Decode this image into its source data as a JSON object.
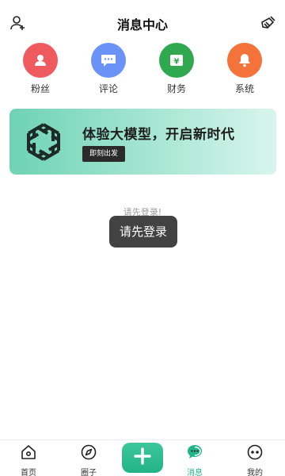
{
  "header": {
    "title": "消息中心",
    "left_icon": "add-user-icon",
    "right_icon": "broom-clear-icon"
  },
  "quick_actions": [
    {
      "label": "粉丝",
      "icon": "fans-icon",
      "color": "#ef5a5f"
    },
    {
      "label": "评论",
      "icon": "comment-icon",
      "color": "#6b93f7"
    },
    {
      "label": "财务",
      "icon": "finance-yen-icon",
      "color": "#2fa84f"
    },
    {
      "label": "系统",
      "icon": "bell-icon",
      "color": "#f3733b"
    }
  ],
  "banner": {
    "headline": "体验大模型，开启新时代",
    "cta": "即刻出发",
    "logo_icon": "ai-knot-logo"
  },
  "empty_state": {
    "hint": "请先登录!",
    "toast": "请先登录"
  },
  "bottom_nav": {
    "items": [
      {
        "label": "首页",
        "icon": "home-icon"
      },
      {
        "label": "圈子",
        "icon": "compass-icon"
      },
      {
        "label": "消息",
        "icon": "message-icon",
        "active": true
      },
      {
        "label": "我的",
        "icon": "profile-icon"
      }
    ],
    "plus_icon": "plus-icon",
    "accent": "#23b58a"
  }
}
